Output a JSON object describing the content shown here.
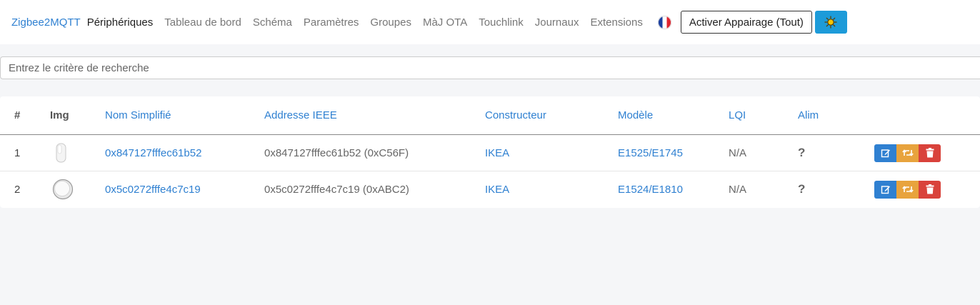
{
  "navbar": {
    "brand": "Zigbee2MQTT",
    "links": [
      {
        "label": "Périphériques",
        "active": true
      },
      {
        "label": "Tableau de bord",
        "active": false
      },
      {
        "label": "Schéma",
        "active": false
      },
      {
        "label": "Paramètres",
        "active": false
      },
      {
        "label": "Groupes",
        "active": false
      },
      {
        "label": "MàJ OTA",
        "active": false
      },
      {
        "label": "Touchlink",
        "active": false
      },
      {
        "label": "Journaux",
        "active": false
      },
      {
        "label": "Extensions",
        "active": false
      }
    ],
    "language_icon": "france-flag-icon",
    "pair_button": "Activer Appairage (Tout)",
    "theme_icon": "sun-icon"
  },
  "search": {
    "placeholder": "Entrez le critère de recherche",
    "value": ""
  },
  "table": {
    "headers": [
      "#",
      "Img",
      "Nom Simplifié",
      "Addresse IEEE",
      "Constructeur",
      "Modèle",
      "LQI",
      "Alim"
    ],
    "rows": [
      {
        "num": "1",
        "image": "remote-device-image",
        "friendly_name": "0x847127fffec61b52",
        "ieee": "0x847127fffec61b52 (0xC56F)",
        "vendor": "IKEA",
        "model": "E1525/E1745",
        "lqi": "N/A",
        "power": "?"
      },
      {
        "num": "2",
        "image": "round-button-device-image",
        "friendly_name": "0x5c0272fffe4c7c19",
        "ieee": "0x5c0272fffe4c7c19 (0xABC2)",
        "vendor": "IKEA",
        "model": "E1524/E1810",
        "lqi": "N/A",
        "power": "?"
      }
    ],
    "action_icons": [
      "edit-icon",
      "retweet-icon",
      "trash-icon"
    ]
  },
  "colors": {
    "accent": "#2f80d1",
    "theme_button": "#1d9bd9",
    "rename_button": "#e8a33d",
    "remove_button": "#d9423b"
  }
}
